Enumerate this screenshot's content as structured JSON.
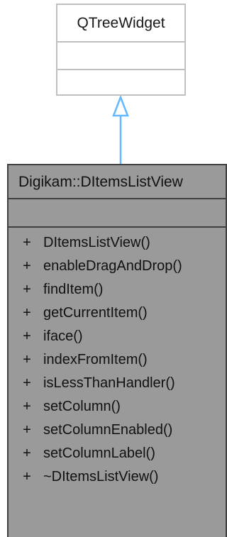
{
  "base_class": {
    "name": "QTreeWidget"
  },
  "derived_class": {
    "name": "Digikam::DItemsListView",
    "methods": [
      {
        "visibility": "+",
        "name": "DItemsListView()"
      },
      {
        "visibility": "+",
        "name": "enableDragAndDrop()"
      },
      {
        "visibility": "+",
        "name": "findItem()"
      },
      {
        "visibility": "+",
        "name": "getCurrentItem()"
      },
      {
        "visibility": "+",
        "name": "iface()"
      },
      {
        "visibility": "+",
        "name": "indexFromItem()"
      },
      {
        "visibility": "+",
        "name": "isLessThanHandler()"
      },
      {
        "visibility": "+",
        "name": "setColumn()"
      },
      {
        "visibility": "+",
        "name": "setColumnEnabled()"
      },
      {
        "visibility": "+",
        "name": "setColumnLabel()"
      },
      {
        "visibility": "+",
        "name": "~DItemsListView()"
      }
    ]
  },
  "colors": {
    "base_border": "#c0c0c0",
    "derived_fill": "#9a9a9a",
    "derived_border": "#404040",
    "arrow": "#63b8ff"
  }
}
